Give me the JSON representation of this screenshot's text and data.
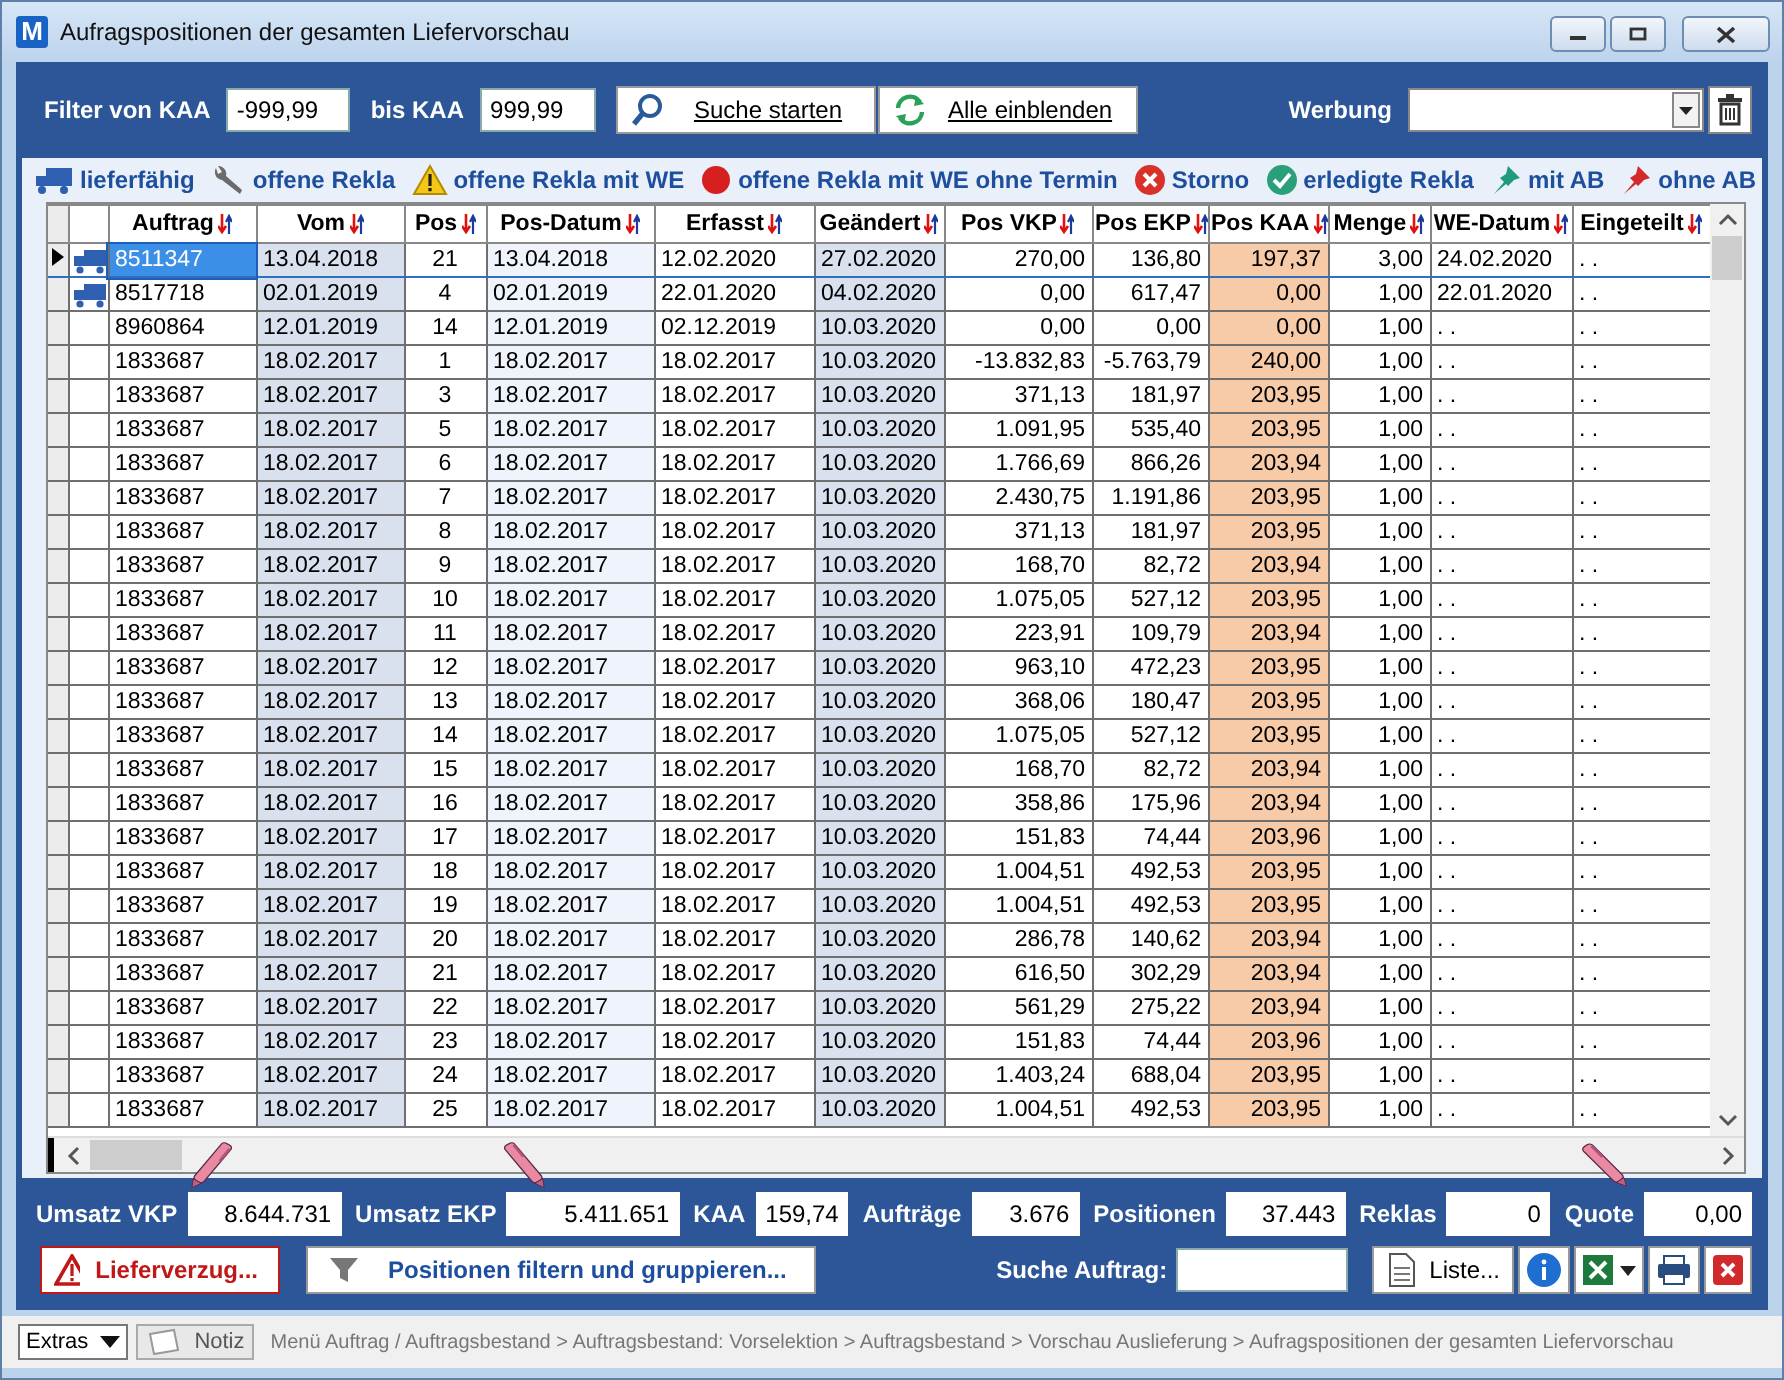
{
  "window": {
    "app_icon": "M",
    "title": "Aufragspositionen der gesamten Liefervorschau"
  },
  "filter": {
    "from_label": "Filter von KAA",
    "from_value": "-999,99",
    "to_label": "bis KAA",
    "to_value": "999,99",
    "search_button": "Suche starten",
    "show_all_button": "Alle einblenden",
    "werbung_label": "Werbung"
  },
  "legend": [
    {
      "kind": "truck",
      "label": "lieferfähig"
    },
    {
      "kind": "wrench",
      "label": "offene Rekla"
    },
    {
      "kind": "warning",
      "label": "offene Rekla mit WE"
    },
    {
      "kind": "dot",
      "label": "offene Rekla mit WE ohne Termin"
    },
    {
      "kind": "cancel",
      "label": "Storno"
    },
    {
      "kind": "done",
      "label": "erledigte Rekla"
    },
    {
      "kind": "pin-green",
      "label": "mit AB"
    },
    {
      "kind": "pin-red",
      "label": "ohne AB"
    }
  ],
  "table": {
    "columns": [
      {
        "label": "Auftrag",
        "kind": "text"
      },
      {
        "label": "Vom",
        "kind": "text-dim"
      },
      {
        "label": "Pos",
        "kind": "center"
      },
      {
        "label": "Pos-Datum",
        "kind": "text-pale"
      },
      {
        "label": "Erfasst",
        "kind": "text"
      },
      {
        "label": "Geändert",
        "kind": "text-dim"
      },
      {
        "label": "Pos VKP",
        "kind": "number"
      },
      {
        "label": "Pos EKP",
        "kind": "number"
      },
      {
        "label": "Pos KAA",
        "kind": "number-highlight"
      },
      {
        "label": "Menge",
        "kind": "number"
      },
      {
        "label": "WE-Datum",
        "kind": "text"
      },
      {
        "label": "Eingeteilt",
        "kind": "text"
      }
    ],
    "rows": [
      {
        "selected": true,
        "kind": "deliverable",
        "cells": [
          "8511347",
          "13.04.2018",
          "21",
          "13.04.2018",
          "12.02.2020",
          "27.02.2020",
          "270,00",
          "136,80",
          "197,37",
          "3,00",
          "24.02.2020",
          ". ."
        ]
      },
      {
        "selected": false,
        "kind": "deliverable",
        "cells": [
          "8517718",
          "02.01.2019",
          "4",
          "02.01.2019",
          "22.01.2020",
          "04.02.2020",
          "0,00",
          "617,47",
          "0,00",
          "1,00",
          "22.01.2020",
          ". ."
        ]
      },
      {
        "selected": false,
        "kind": "plain",
        "cells": [
          "8960864",
          "12.01.2019",
          "14",
          "12.01.2019",
          "02.12.2019",
          "10.03.2020",
          "0,00",
          "0,00",
          "0,00",
          "1,00",
          ". .",
          ". ."
        ]
      },
      {
        "selected": false,
        "kind": "plain",
        "cells": [
          "1833687",
          "18.02.2017",
          "1",
          "18.02.2017",
          "18.02.2017",
          "10.03.2020",
          "-13.832,83",
          "-5.763,79",
          "240,00",
          "1,00",
          ". .",
          ". ."
        ]
      },
      {
        "selected": false,
        "kind": "plain",
        "cells": [
          "1833687",
          "18.02.2017",
          "3",
          "18.02.2017",
          "18.02.2017",
          "10.03.2020",
          "371,13",
          "181,97",
          "203,95",
          "1,00",
          ". .",
          ". ."
        ]
      },
      {
        "selected": false,
        "kind": "plain",
        "cells": [
          "1833687",
          "18.02.2017",
          "5",
          "18.02.2017",
          "18.02.2017",
          "10.03.2020",
          "1.091,95",
          "535,40",
          "203,95",
          "1,00",
          ". .",
          ". ."
        ]
      },
      {
        "selected": false,
        "kind": "plain",
        "cells": [
          "1833687",
          "18.02.2017",
          "6",
          "18.02.2017",
          "18.02.2017",
          "10.03.2020",
          "1.766,69",
          "866,26",
          "203,94",
          "1,00",
          ". .",
          ". ."
        ]
      },
      {
        "selected": false,
        "kind": "plain",
        "cells": [
          "1833687",
          "18.02.2017",
          "7",
          "18.02.2017",
          "18.02.2017",
          "10.03.2020",
          "2.430,75",
          "1.191,86",
          "203,95",
          "1,00",
          ". .",
          ". ."
        ]
      },
      {
        "selected": false,
        "kind": "plain",
        "cells": [
          "1833687",
          "18.02.2017",
          "8",
          "18.02.2017",
          "18.02.2017",
          "10.03.2020",
          "371,13",
          "181,97",
          "203,95",
          "1,00",
          ". .",
          ". ."
        ]
      },
      {
        "selected": false,
        "kind": "plain",
        "cells": [
          "1833687",
          "18.02.2017",
          "9",
          "18.02.2017",
          "18.02.2017",
          "10.03.2020",
          "168,70",
          "82,72",
          "203,94",
          "1,00",
          ". .",
          ". ."
        ]
      },
      {
        "selected": false,
        "kind": "plain",
        "cells": [
          "1833687",
          "18.02.2017",
          "10",
          "18.02.2017",
          "18.02.2017",
          "10.03.2020",
          "1.075,05",
          "527,12",
          "203,95",
          "1,00",
          ". .",
          ". ."
        ]
      },
      {
        "selected": false,
        "kind": "plain",
        "cells": [
          "1833687",
          "18.02.2017",
          "11",
          "18.02.2017",
          "18.02.2017",
          "10.03.2020",
          "223,91",
          "109,79",
          "203,94",
          "1,00",
          ". .",
          ". ."
        ]
      },
      {
        "selected": false,
        "kind": "plain",
        "cells": [
          "1833687",
          "18.02.2017",
          "12",
          "18.02.2017",
          "18.02.2017",
          "10.03.2020",
          "963,10",
          "472,23",
          "203,95",
          "1,00",
          ". .",
          ". ."
        ]
      },
      {
        "selected": false,
        "kind": "plain",
        "cells": [
          "1833687",
          "18.02.2017",
          "13",
          "18.02.2017",
          "18.02.2017",
          "10.03.2020",
          "368,06",
          "180,47",
          "203,95",
          "1,00",
          ". .",
          ". ."
        ]
      },
      {
        "selected": false,
        "kind": "plain",
        "cells": [
          "1833687",
          "18.02.2017",
          "14",
          "18.02.2017",
          "18.02.2017",
          "10.03.2020",
          "1.075,05",
          "527,12",
          "203,95",
          "1,00",
          ". .",
          ". ."
        ]
      },
      {
        "selected": false,
        "kind": "plain",
        "cells": [
          "1833687",
          "18.02.2017",
          "15",
          "18.02.2017",
          "18.02.2017",
          "10.03.2020",
          "168,70",
          "82,72",
          "203,94",
          "1,00",
          ". .",
          ". ."
        ]
      },
      {
        "selected": false,
        "kind": "plain",
        "cells": [
          "1833687",
          "18.02.2017",
          "16",
          "18.02.2017",
          "18.02.2017",
          "10.03.2020",
          "358,86",
          "175,96",
          "203,94",
          "1,00",
          ". .",
          ". ."
        ]
      },
      {
        "selected": false,
        "kind": "plain",
        "cells": [
          "1833687",
          "18.02.2017",
          "17",
          "18.02.2017",
          "18.02.2017",
          "10.03.2020",
          "151,83",
          "74,44",
          "203,96",
          "1,00",
          ". .",
          ". ."
        ]
      },
      {
        "selected": false,
        "kind": "plain",
        "cells": [
          "1833687",
          "18.02.2017",
          "18",
          "18.02.2017",
          "18.02.2017",
          "10.03.2020",
          "1.004,51",
          "492,53",
          "203,95",
          "1,00",
          ". .",
          ". ."
        ]
      },
      {
        "selected": false,
        "kind": "plain",
        "cells": [
          "1833687",
          "18.02.2017",
          "19",
          "18.02.2017",
          "18.02.2017",
          "10.03.2020",
          "1.004,51",
          "492,53",
          "203,95",
          "1,00",
          ". .",
          ". ."
        ]
      },
      {
        "selected": false,
        "kind": "plain",
        "cells": [
          "1833687",
          "18.02.2017",
          "20",
          "18.02.2017",
          "18.02.2017",
          "10.03.2020",
          "286,78",
          "140,62",
          "203,94",
          "1,00",
          ". .",
          ". ."
        ]
      },
      {
        "selected": false,
        "kind": "plain",
        "cells": [
          "1833687",
          "18.02.2017",
          "21",
          "18.02.2017",
          "18.02.2017",
          "10.03.2020",
          "616,50",
          "302,29",
          "203,94",
          "1,00",
          ". .",
          ". ."
        ]
      },
      {
        "selected": false,
        "kind": "plain",
        "cells": [
          "1833687",
          "18.02.2017",
          "22",
          "18.02.2017",
          "18.02.2017",
          "10.03.2020",
          "561,29",
          "275,22",
          "203,94",
          "1,00",
          ". .",
          ". ."
        ]
      },
      {
        "selected": false,
        "kind": "plain",
        "cells": [
          "1833687",
          "18.02.2017",
          "23",
          "18.02.2017",
          "18.02.2017",
          "10.03.2020",
          "151,83",
          "74,44",
          "203,96",
          "1,00",
          ". .",
          ". ."
        ]
      },
      {
        "selected": false,
        "kind": "plain",
        "cells": [
          "1833687",
          "18.02.2017",
          "24",
          "18.02.2017",
          "18.02.2017",
          "10.03.2020",
          "1.403,24",
          "688,04",
          "203,95",
          "1,00",
          ". .",
          ". ."
        ]
      },
      {
        "selected": false,
        "kind": "plain",
        "cells": [
          "1833687",
          "18.02.2017",
          "25",
          "18.02.2017",
          "18.02.2017",
          "10.03.2020",
          "1.004,51",
          "492,53",
          "203,95",
          "1,00",
          ". .",
          ". ."
        ]
      }
    ]
  },
  "totals": [
    {
      "label": "Umsatz VKP",
      "value": "8.644.731"
    },
    {
      "label": "Umsatz EKP",
      "value": "5.411.651"
    },
    {
      "label": "KAA",
      "value": "159,74"
    },
    {
      "label": "Aufträge",
      "value": "3.676"
    },
    {
      "label": "Positionen",
      "value": "37.443"
    },
    {
      "label": "Reklas",
      "value": "0"
    },
    {
      "label": "Quote",
      "value": "0,00"
    }
  ],
  "actions": {
    "delay_button": "Lieferverzug...",
    "filter_button": "Positionen filtern und gruppieren...",
    "search_label": "Suche Auftrag:",
    "list_button": "Liste..."
  },
  "status_bar": {
    "extras": "Extras",
    "note": "Notiz",
    "breadcrumb": "Menü Auftrag / Auftragsbestand > Auftragsbestand: Vorselektion > Auftragsbestand > Vorschau Auslieferung > Aufragspositionen der gesamten Liefervorschau"
  }
}
